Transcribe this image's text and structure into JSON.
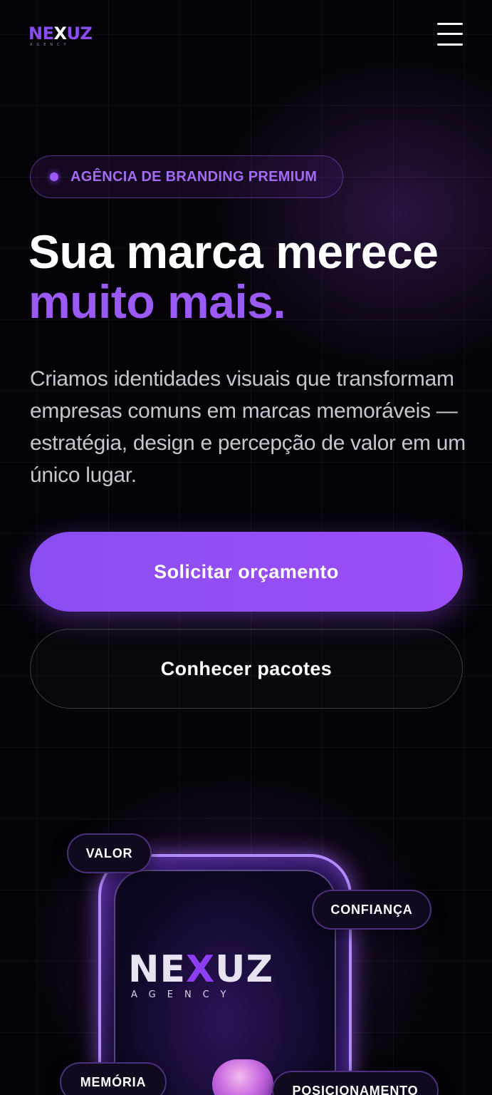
{
  "header": {
    "logo_text_a": "NE",
    "logo_text_x": "X",
    "logo_text_b": "UZ",
    "logo_sub": "AGENCY"
  },
  "hero": {
    "badge": "AGÊNCIA DE BRANDING PREMIUM",
    "title_line1": "Sua marca merece",
    "title_line2": "muito mais.",
    "lead": "Criamos identidades visuais que transformam empresas comuns em marcas memoráveis — estratégia, design e percepção de valor em um único lugar.",
    "primary_cta": "Solicitar orçamento",
    "secondary_cta": "Conhecer pacotes"
  },
  "showcase": {
    "logo_text_a": "NE",
    "logo_text_x": "X",
    "logo_text_b": "UZ",
    "logo_sub": "AGENCY",
    "chips": [
      "VALOR",
      "CONFIANÇA",
      "MEMÓRIA",
      "POSICIONAMENTO"
    ]
  },
  "colors": {
    "accent": "#9b59f5",
    "background": "#050307",
    "text": "#ffffff",
    "muted": "#c9c4d2"
  },
  "icons": {
    "menu": "hamburger-menu-icon",
    "badge_dot": "status-dot-icon"
  }
}
